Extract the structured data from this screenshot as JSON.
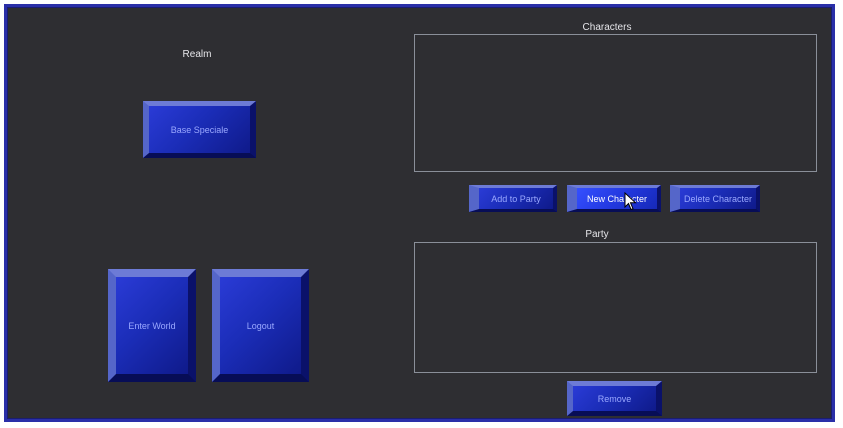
{
  "realm": {
    "label": "Realm",
    "button_label": "Base Speciale"
  },
  "characters": {
    "label": "Characters",
    "add_to_party_label": "Add to Party",
    "new_character_label": "New Character",
    "delete_character_label": "Delete Character"
  },
  "party": {
    "label": "Party",
    "remove_label": "Remove"
  },
  "actions": {
    "enter_world_label": "Enter World",
    "logout_label": "Logout"
  },
  "colors": {
    "background": "#2e2e32",
    "frame_border": "#2a2fa8",
    "button_face": "#1b2db8",
    "button_text": "#9aa8ff"
  },
  "icons": {
    "cursor": "arrow-cursor-icon"
  }
}
